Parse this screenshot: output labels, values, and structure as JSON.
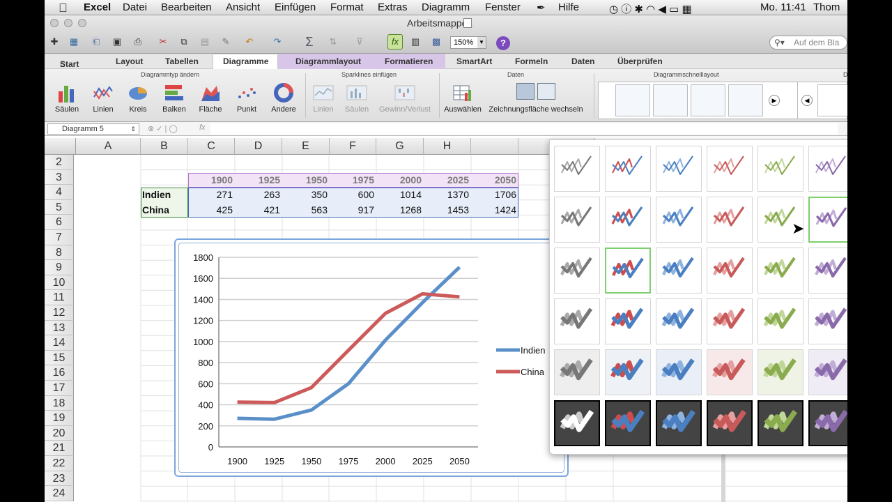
{
  "menubar": {
    "apple": "",
    "app": "Excel",
    "items": [
      "Datei",
      "Bearbeiten",
      "Ansicht",
      "Einfügen",
      "Format",
      "Extras",
      "Diagramm",
      "Fenster",
      "Hilfe"
    ],
    "clock": "Mo. 11:41",
    "user": "Thom"
  },
  "window": {
    "title": "Arbeitsmappe1"
  },
  "toolbar": {
    "zoom": "150%",
    "search_placeholder": "Auf dem Bla"
  },
  "tabs": [
    "Start",
    "Layout",
    "Tabellen",
    "Diagramme",
    "Diagrammlayout",
    "Formatieren",
    "SmartArt",
    "Formeln",
    "Daten",
    "Überprüfen"
  ],
  "ribbon": {
    "groups": [
      "Diagrammtyp ändern",
      "Sparklines einfügen",
      "Daten",
      "Diagrammschnelllayout",
      "D"
    ],
    "chart_types": [
      "Säulen",
      "Linien",
      "Kreis",
      "Balken",
      "Fläche",
      "Punkt",
      "Andere"
    ],
    "sparklines": [
      "Linien",
      "Säulen",
      "Gewinn/Verlust"
    ],
    "data_buttons": [
      "Auswählen",
      "Zeichnungsfläche wechseln"
    ]
  },
  "formula": {
    "namebox": "Diagramm 5",
    "fx": "fx"
  },
  "sheet": {
    "columns": [
      "A",
      "B",
      "C",
      "D",
      "E",
      "F",
      "G",
      "H"
    ],
    "rows": [
      "2",
      "3",
      "4",
      "5",
      "6",
      "7",
      "8",
      "9",
      "10",
      "11",
      "12",
      "13",
      "14",
      "15",
      "16",
      "17",
      "18",
      "19",
      "20",
      "21",
      "22",
      "23",
      "24"
    ],
    "years": [
      "1900",
      "1925",
      "1950",
      "1975",
      "2000",
      "2025",
      "2050"
    ],
    "labels": [
      "Indien",
      "China"
    ],
    "indien": [
      "271",
      "263",
      "350",
      "600",
      "1014",
      "1370",
      "1706"
    ],
    "china": [
      "425",
      "421",
      "563",
      "917",
      "1268",
      "1453",
      "1424"
    ]
  },
  "colors": {
    "indien": "#5b8fc9",
    "china": "#cd5a5a",
    "accent_tab": "#b99bd4",
    "selection_green": "#7ccf6c"
  },
  "chart_data": {
    "type": "line",
    "categories": [
      "1900",
      "1925",
      "1950",
      "1975",
      "2000",
      "2025",
      "2050"
    ],
    "series": [
      {
        "name": "Indien",
        "values": [
          271,
          263,
          350,
          600,
          1014,
          1370,
          1706
        ]
      },
      {
        "name": "China",
        "values": [
          425,
          421,
          563,
          917,
          1268,
          1453,
          1424
        ]
      }
    ],
    "yticks": [
      "0",
      "200",
      "400",
      "600",
      "800",
      "1000",
      "1200",
      "1400",
      "1600",
      "1800"
    ],
    "ylim": [
      0,
      1800
    ],
    "grid": true,
    "legend": "right"
  },
  "gallery": {
    "palettes": [
      "gray",
      "multi",
      "blue",
      "red",
      "green",
      "purple"
    ],
    "rows": 6,
    "selected": [
      [
        2,
        1
      ],
      [
        1,
        5
      ]
    ]
  }
}
